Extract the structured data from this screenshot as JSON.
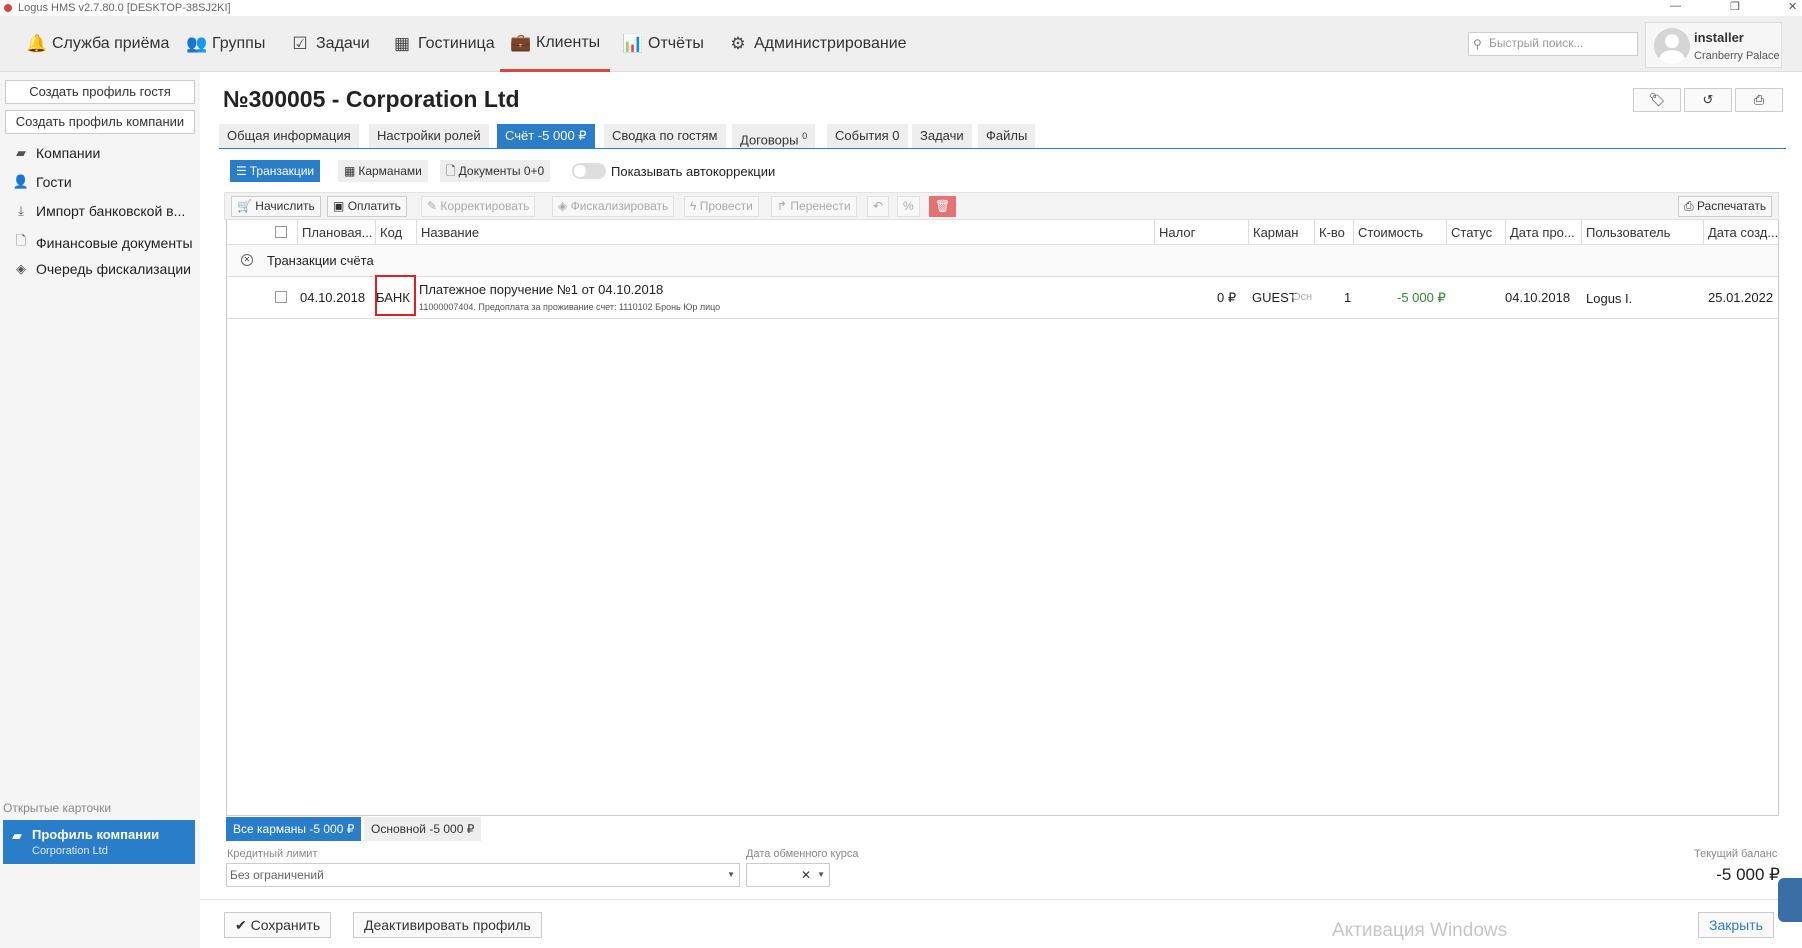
{
  "window": {
    "title": "Logus HMS v2.7.80.0 [DESKTOP-38SJ2KI]",
    "min": "—",
    "restore": "❐",
    "close": "✕"
  },
  "nav": [
    {
      "label": "Служба приёма",
      "icon": "bell-icon",
      "glyph": "🔔"
    },
    {
      "label": "Группы",
      "icon": "users-icon",
      "glyph": "👥"
    },
    {
      "label": "Задачи",
      "icon": "calendar-check-icon",
      "glyph": "☑"
    },
    {
      "label": "Гостиница",
      "icon": "building-icon",
      "glyph": "▦"
    },
    {
      "label": "Клиенты",
      "icon": "briefcase-icon",
      "glyph": "💼"
    },
    {
      "label": "Отчёты",
      "icon": "bar-chart-icon",
      "glyph": "📊"
    },
    {
      "label": "Администрирование",
      "icon": "gears-icon",
      "glyph": "⚙"
    }
  ],
  "search": {
    "placeholder": "Быстрый поиск..."
  },
  "user": {
    "name": "installer",
    "hotel": "Cranberry Palace"
  },
  "sidebar": {
    "create_guest": "Создать профиль гостя",
    "create_company": "Создать профиль компании",
    "items": [
      {
        "label": "Компании",
        "glyph": "▰"
      },
      {
        "label": "Гости",
        "glyph": "👤"
      },
      {
        "label": "Импорт банковской в...",
        "glyph": "⤓"
      },
      {
        "label": "Финансовые документы",
        "glyph": "🗋"
      },
      {
        "label": "Очередь фискализации",
        "glyph": "◈"
      }
    ],
    "open_cards_label": "Открытые карточки",
    "open_card": {
      "title": "Профиль компании",
      "subtitle": "Corporation Ltd"
    }
  },
  "page": {
    "title": "№300005 - Corporation Ltd"
  },
  "tabs": [
    {
      "label": "Общая информация"
    },
    {
      "label": "Настройки ролей"
    },
    {
      "label": "Счёт -5 000 ₽"
    },
    {
      "label": "Сводка по гостям"
    },
    {
      "label": "Договоры",
      "badge": "0"
    },
    {
      "label": "События 0"
    },
    {
      "label": "Задачи"
    },
    {
      "label": "Файлы"
    }
  ],
  "subtabs": {
    "transactions": "Транзакции",
    "pockets": "Карманами",
    "documents": "Документы 0+0",
    "autocorrections": "Показывать автокоррекции"
  },
  "toolbar": {
    "charge": "Начислить",
    "pay": "Оплатить",
    "correct": "Корректировать",
    "fiscalize": "Фискализировать",
    "post": "Провести",
    "transfer": "Перенести",
    "print": "Распечатать"
  },
  "grid": {
    "columns": [
      "Плановая...",
      "Код",
      "Название",
      "Налог",
      "Карман",
      "К-во",
      "Стоимость",
      "Статус",
      "Дата про...",
      "Пользователь",
      "Дата созд..."
    ],
    "group_label": "Транзакции счёта",
    "rows": [
      {
        "date": "04.10.2018",
        "code": "БАНК",
        "name": "Платежное поручение №1 от 04.10.2018",
        "details": "11000007404. Предоплата за проживание счет: 1110102 Бронь Юр лицо",
        "tax": "0 ₽",
        "pocket": "GUEST",
        "pocket_sub": "Осн",
        "qty": "1",
        "cost": "-5 000 ₽",
        "status": "",
        "post_date": "04.10.2018",
        "user": "Logus I.",
        "created": "25.01.2022"
      }
    ]
  },
  "pockets": {
    "all": "Все карманы -5 000 ₽",
    "main": "Основной -5 000 ₽"
  },
  "credit": {
    "label": "Кредитный лимит",
    "value": "Без ограничений"
  },
  "exchange": {
    "label": "Дата обменного курса"
  },
  "balance": {
    "label": "Текущий баланс",
    "value": "-5 000 ₽"
  },
  "footer": {
    "save": "Сохранить",
    "deactivate": "Деактивировать профиль",
    "close": "Закрыть",
    "watermark": "Активация Windows"
  },
  "colors": {
    "accent": "#2a7dc8",
    "nav_active": "#d9463a",
    "positive": "#2e8b2e",
    "highlight": "#e02020"
  }
}
